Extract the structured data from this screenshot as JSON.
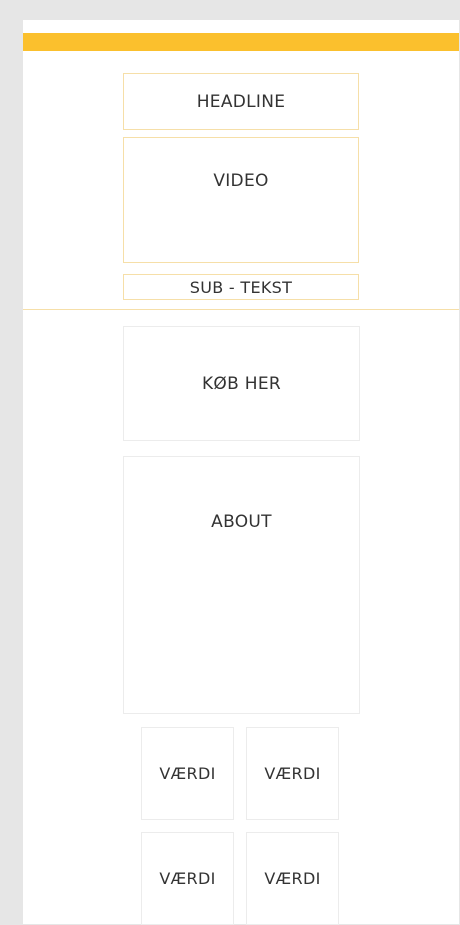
{
  "colors": {
    "accent": "#fbc02d",
    "hero_border": "#f6dfa8",
    "box_border": "#ececec",
    "background": "#e6e6e6"
  },
  "hero": {
    "headline": "HEADLINE",
    "video": "VIDEO",
    "sub_text": "SUB - TEKST"
  },
  "buy": {
    "label": "KØB HER"
  },
  "about": {
    "label": "ABOUT"
  },
  "values": [
    "VÆRDI",
    "VÆRDI",
    "VÆRDI",
    "VÆRDI"
  ]
}
